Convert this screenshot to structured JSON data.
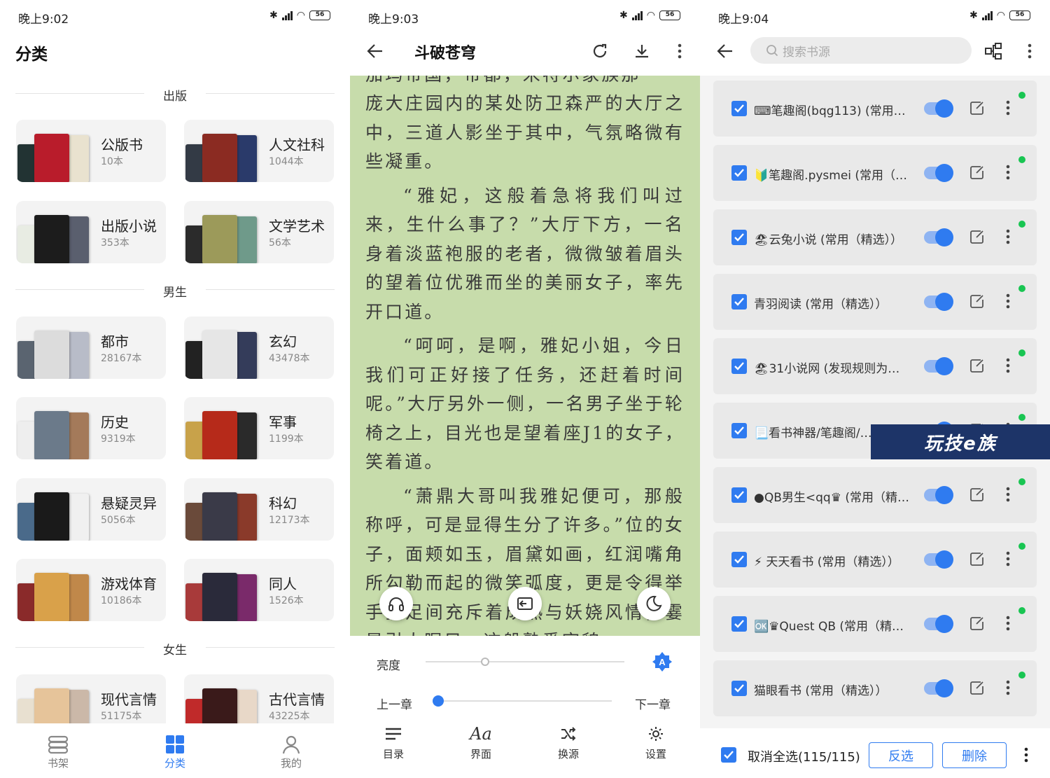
{
  "panel1": {
    "status_time": "晚上9:02",
    "battery": "56",
    "title": "分类",
    "sections": {
      "publish": "出版",
      "male": "男生",
      "female": "女生"
    },
    "categories": [
      {
        "name": "公版书",
        "count": "10本"
      },
      {
        "name": "人文社科",
        "count": "1044本"
      },
      {
        "name": "出版小说",
        "count": "353本"
      },
      {
        "name": "文学艺术",
        "count": "56本"
      },
      {
        "name": "都市",
        "count": "28167本"
      },
      {
        "name": "玄幻",
        "count": "43478本"
      },
      {
        "name": "历史",
        "count": "9319本"
      },
      {
        "name": "军事",
        "count": "1199本"
      },
      {
        "name": "悬疑灵异",
        "count": "5056本"
      },
      {
        "name": "科幻",
        "count": "12173本"
      },
      {
        "name": "游戏体育",
        "count": "10186本"
      },
      {
        "name": "同人",
        "count": "1526本"
      },
      {
        "name": "现代言情",
        "count": "51175本"
      },
      {
        "name": "古代言情",
        "count": "43225本"
      }
    ],
    "nav": {
      "bookshelf": "书架",
      "category": "分类",
      "mine": "我的"
    },
    "accent": "#2f7bf0"
  },
  "panel2": {
    "status_time": "晚上9:03",
    "battery": "56",
    "title": "斗破苍穹",
    "paragraphs": [
      "庞大庄园内的某处防卫森严的大厅之中，三道人影坐于其中，气氛略微有些凝重。",
      "“雅妃，这般着急将我们叫过来，生什么事了？”大厅下方，一名身着淡蓝袍服的老者，微微皱着眉头的望着位优雅而坐的美丽女子，率先开口道。",
      "“呵呵，是啊，雅妃小姐，今日我们可正好接了任务，还赶着时间呢。”大厅另外一侧，一名男子坐于轮椅之上，目光也是望着座J1的女子，笑着道。",
      "“萧鼎大哥叫我雅妃便可，那般称呼，可是显得生分了许多。”位的女子，面颊如玉，眉黛如画，红润嘴角所勾勒而起的微笑弧度，更是令得举手投足间充斥着成熟与妖娆风情，霎是引人瞩目，这般熟悉宛貌"
    ],
    "brightness_label": "亮度",
    "brightness": 0.3,
    "prev_chapter": "上一章",
    "next_chapter": "下一章",
    "chapter_progress": 0.0,
    "tools": {
      "toc": "目录",
      "ui": "界面",
      "source": "换源",
      "settings": "设置"
    },
    "reader_bg": "#c7dcab"
  },
  "panel3": {
    "status_time": "晚上9:04",
    "battery": "56",
    "search_placeholder": "搜索书源",
    "sources": [
      {
        "name": "⌨笔趣阁(bqg113) (常用（…"
      },
      {
        "name": "🔰笔趣阁.pysmei (常用（…"
      },
      {
        "name": "🏖云兔小说 (常用（精选））"
      },
      {
        "name": "青羽阅读 (常用（精选））"
      },
      {
        "name": "🏖31小说网 (发现规则为…"
      },
      {
        "name": "📃看书神器/笔趣阁/…"
      },
      {
        "name": "●QB男生<qq♛ (常用（精…"
      },
      {
        "name": "⚡ 天天看书 (常用（精选））"
      },
      {
        "name": "🆗♛Quest QB (常用（精…"
      },
      {
        "name": "猫眼看书 (常用（精选））"
      }
    ],
    "select_all": "取消全选(115/115)",
    "invert": "反选",
    "delete": "删除",
    "watermark": "玩技e族"
  }
}
